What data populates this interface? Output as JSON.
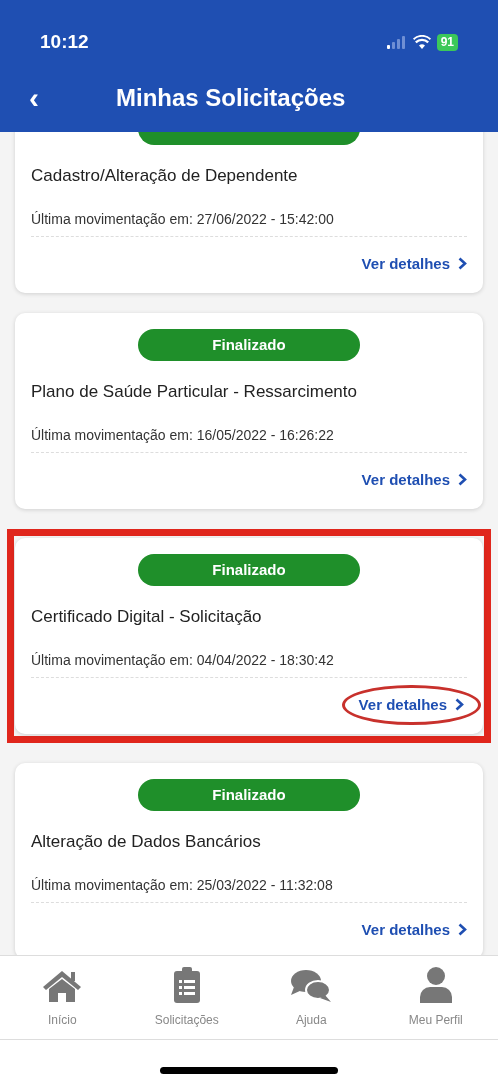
{
  "status_bar": {
    "time": "10:12",
    "battery": "91"
  },
  "header": {
    "back": "‹",
    "title": "Minhas Solicitações"
  },
  "requests": [
    {
      "title": "Cadastro/Alteração de Dependente",
      "last_update": "Última movimentação em: 27/06/2022 - 15:42:00",
      "link": "Ver detalhes",
      "highlighted": false
    },
    {
      "status": "Finalizado",
      "title": "Plano de Saúde Particular - Ressarcimento",
      "last_update": "Última movimentação em: 16/05/2022 - 16:26:22",
      "link": "Ver detalhes",
      "highlighted": false
    },
    {
      "status": "Finalizado",
      "title": "Certificado Digital - Solicitação",
      "last_update": "Última movimentação em: 04/04/2022 - 18:30:42",
      "link": "Ver detalhes",
      "highlighted": true
    },
    {
      "status": "Finalizado",
      "title": "Alteração de Dados Bancários",
      "last_update": "Última movimentação em: 25/03/2022 - 11:32:08",
      "link": "Ver detalhes",
      "highlighted": false
    }
  ],
  "tab_bar": [
    {
      "kind": "home",
      "label": "Início",
      "selected": false
    },
    {
      "kind": "clipboard",
      "label": "Solicitações",
      "selected": false
    },
    {
      "kind": "chat",
      "label": "Ajuda",
      "selected": false
    },
    {
      "kind": "person",
      "label": "Meu Perfil",
      "selected": false
    }
  ]
}
